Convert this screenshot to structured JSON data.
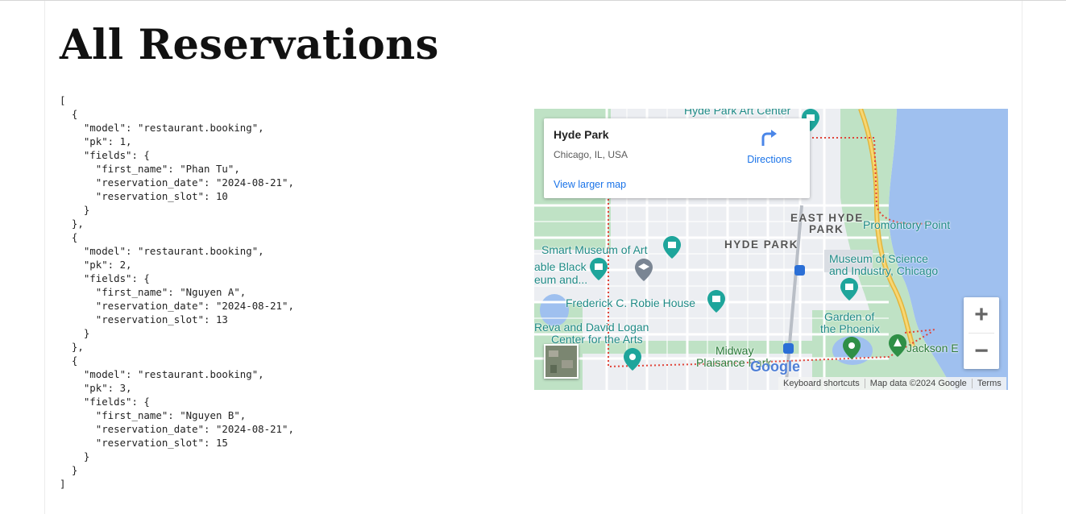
{
  "page": {
    "title": "All Reservations",
    "json_text": "[\n  {\n    \"model\": \"restaurant.booking\",\n    \"pk\": 1,\n    \"fields\": {\n      \"first_name\": \"Phan Tu\",\n      \"reservation_date\": \"2024-08-21\",\n      \"reservation_slot\": 10\n    }\n  },\n  {\n    \"model\": \"restaurant.booking\",\n    \"pk\": 2,\n    \"fields\": {\n      \"first_name\": \"Nguyen A\",\n      \"reservation_date\": \"2024-08-21\",\n      \"reservation_slot\": 13\n    }\n  },\n  {\n    \"model\": \"restaurant.booking\",\n    \"pk\": 3,\n    \"fields\": {\n      \"first_name\": \"Nguyen B\",\n      \"reservation_date\": \"2024-08-21\",\n      \"reservation_slot\": 15\n    }\n  }\n]"
  },
  "map": {
    "card": {
      "place_name": "Hyde Park",
      "address": "Chicago, IL, USA",
      "directions_label": "Directions",
      "larger_map_link": "View larger map"
    },
    "labels": {
      "art_center": "Hyde Park Art Center",
      "east_hyde_park_1": "EAST HYDE",
      "east_hyde_park_2": "PARK",
      "promontory_point": "Promontory Point",
      "smart_museum": "Smart Museum of Art",
      "hyde_park": "HYDE PARK",
      "museum_science_1": "Museum of Science",
      "museum_science_2": "and Industry, Chicago",
      "able_black": "able Black",
      "eum_and": "eum and...",
      "robie_house": "Frederick C. Robie House",
      "garden_1": "Garden of",
      "garden_2": "the Phoenix",
      "logan_1": "Reva and David Logan",
      "logan_2": "Center for the Arts",
      "midway_1": "Midway",
      "midway_2": "Plaisance Park",
      "jackson": "Jackson E"
    },
    "zoom_in": "+",
    "zoom_out": "−",
    "google_logo": "Google",
    "attribution": {
      "shortcuts": "Keyboard shortcuts",
      "map_data": "Map data ©2024 Google",
      "terms": "Terms"
    },
    "colors": {
      "water": "#9fc0ef",
      "park": "#bfe2c5",
      "highway": "#f2c94c",
      "boundary": "#e0453a",
      "link": "#1a73e8",
      "poi_teal": "#1ea59b"
    }
  }
}
